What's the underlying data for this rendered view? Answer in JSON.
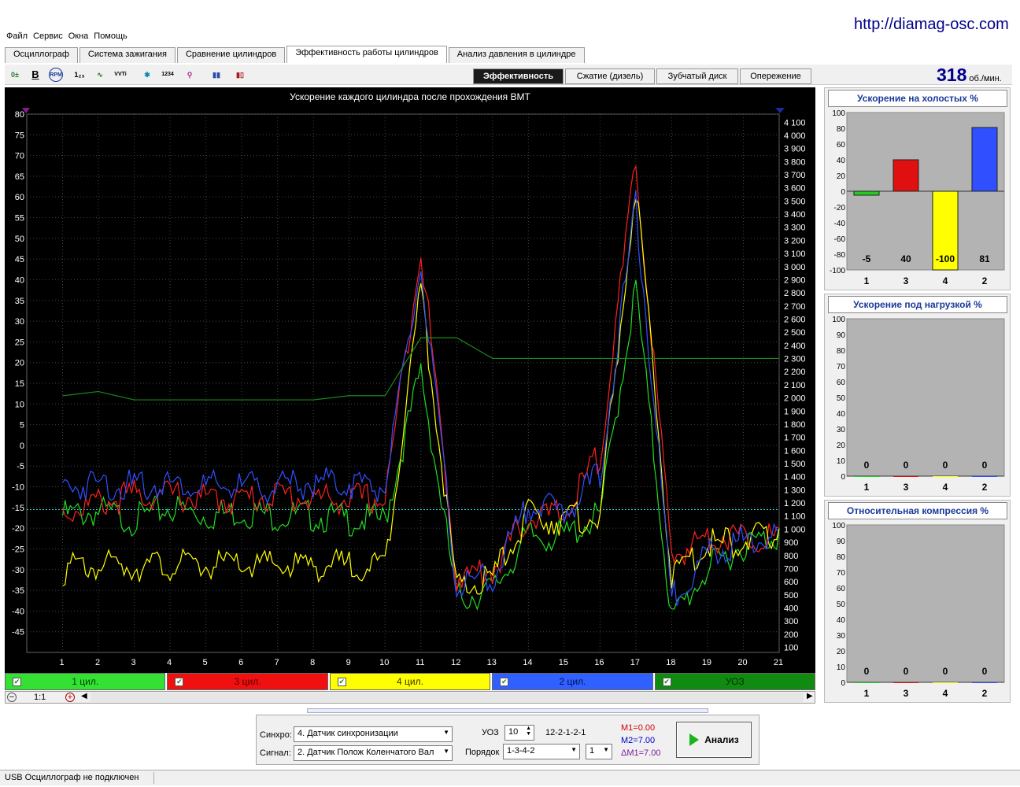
{
  "url": "http://diamag-osc.com",
  "menu": [
    "Файл",
    "Сервис",
    "Окна",
    "Помощь"
  ],
  "tabs": [
    {
      "label": "Осциллограф"
    },
    {
      "label": "Система зажигания"
    },
    {
      "label": "Сравнение цилиндров"
    },
    {
      "label": "Эффективность работы цилиндров",
      "active": true
    },
    {
      "label": "Анализ давления в цилиндре"
    }
  ],
  "subtabs": [
    {
      "label": "Эффективность",
      "active": true
    },
    {
      "label": "Сжатие (дизель)"
    },
    {
      "label": "Зубчатый диск"
    },
    {
      "label": "Опережение"
    }
  ],
  "rpm": {
    "value": "318",
    "unit": "об./мин."
  },
  "chart": {
    "title": "Ускорение каждого цилиндра после прохождения ВМТ",
    "left_ticks": [
      "80",
      "75",
      "70",
      "65",
      "60",
      "55",
      "50",
      "45",
      "40",
      "35",
      "30",
      "25",
      "20",
      "15",
      "10",
      "5",
      "0",
      "-5",
      "-10",
      "-15",
      "-20",
      "-25",
      "-30",
      "-35",
      "-40",
      "-45"
    ],
    "right_ticks": [
      "4 100",
      "4 000",
      "3 900",
      "3 800",
      "3 700",
      "3 600",
      "3 500",
      "3 400",
      "3 300",
      "3 200",
      "3 100",
      "3 000",
      "2 900",
      "2 800",
      "2 700",
      "2 600",
      "2 500",
      "2 400",
      "2 300",
      "2 200",
      "2 100",
      "2 000",
      "1 900",
      "1 800",
      "1 700",
      "1 600",
      "1 500",
      "1 400",
      "1 300",
      "1 200",
      "1 100",
      "1 000",
      "900",
      "800",
      "700",
      "600",
      "500",
      "400",
      "300",
      "200",
      "100"
    ],
    "x_ticks": [
      "1",
      "2",
      "3",
      "4",
      "5",
      "6",
      "7",
      "8",
      "9",
      "10",
      "11",
      "12",
      "13",
      "14",
      "15",
      "16",
      "17",
      "18",
      "19",
      "20",
      "21"
    ]
  },
  "chart_data": {
    "type": "line",
    "title": "Ускорение каждого цилиндра после прохождения ВМТ",
    "ylim": [
      -50,
      80
    ],
    "y2lim": [
      0,
      4100
    ],
    "x": [
      1,
      2,
      3,
      4,
      5,
      6,
      7,
      8,
      9,
      10,
      11,
      12,
      13,
      14,
      15,
      16,
      17,
      18,
      19,
      20,
      21
    ],
    "series": [
      {
        "name": "1 цил.",
        "color": "#22dd22",
        "values": [
          -15,
          -14,
          -16,
          -13,
          -15,
          -14,
          -15,
          -15,
          -16,
          -16,
          20,
          -35,
          -33,
          -20,
          -20,
          -15,
          40,
          -40,
          -28,
          -22,
          -20
        ]
      },
      {
        "name": "3 цил.",
        "color": "#ff2020",
        "values": [
          -14,
          -12,
          -10,
          -10,
          -11,
          -11,
          -10,
          -11,
          -11,
          -11,
          50,
          -30,
          -28,
          -15,
          -15,
          0,
          70,
          -25,
          -20,
          -20,
          -20
        ]
      },
      {
        "name": "4 цил.",
        "color": "#ffff00",
        "values": [
          -28,
          -27,
          -27,
          -27,
          -27,
          -27,
          -27,
          -27,
          -27,
          -27,
          40,
          -33,
          -30,
          -15,
          -16,
          -15,
          65,
          -30,
          -22,
          -21,
          -20
        ]
      },
      {
        "name": "2 цил.",
        "color": "#3050ff",
        "values": [
          -8,
          -7,
          -8,
          -7,
          -8,
          -8,
          -8,
          -7,
          -7,
          -8,
          45,
          -32,
          -30,
          -12,
          -14,
          -5,
          60,
          -35,
          -24,
          -21,
          -20
        ]
      },
      {
        "name": "УОЗ",
        "color": "#1a8a1a",
        "values": [
          12,
          13,
          11,
          11,
          11,
          11,
          11,
          11,
          12,
          12,
          26,
          26,
          21,
          21,
          21,
          21,
          21,
          21,
          21,
          21,
          21
        ]
      }
    ]
  },
  "legend": [
    {
      "label": "1 цил.",
      "bg": "#33e033",
      "fg": "#004400"
    },
    {
      "label": "3 цил.",
      "bg": "#f01010",
      "fg": "#550000"
    },
    {
      "label": "4 цил.",
      "bg": "#ffff00",
      "fg": "#333300"
    },
    {
      "label": "2 цил.",
      "bg": "#3060ff",
      "fg": "#001050"
    },
    {
      "label": "УОЗ",
      "bg": "#108a10",
      "fg": "#003300"
    }
  ],
  "zoom": "1:1",
  "panel": {
    "sync_label": "Синхро:",
    "sync_value": "4.  Датчик синхронизации",
    "signal_label": "Сигнал:",
    "signal_value": "2.  Датчик Полож Коленчатого Вал",
    "uoz_label": "УОЗ",
    "uoz_value": "10",
    "pattern": "12-2-1-2-1",
    "order_label": "Порядок",
    "order_value": "1-3-4-2",
    "order_num": "1",
    "m1": "M1=0.00",
    "m2": "M2=7.00",
    "dm1": "ΔM1=7.00",
    "analyze_label": "Анализ"
  },
  "side": [
    {
      "title": "Ускорение на холостых %",
      "ticks": [
        "100",
        "80",
        "60",
        "40",
        "20",
        "0",
        "-20",
        "-40",
        "-60",
        "-80",
        "-100"
      ],
      "ylim": [
        -100,
        100
      ],
      "bars": [
        {
          "cyl": "1",
          "value": -5,
          "color": "#22cc22"
        },
        {
          "cyl": "3",
          "value": 40,
          "color": "#e01010"
        },
        {
          "cyl": "4",
          "value": -100,
          "color": "#ffff00"
        },
        {
          "cyl": "2",
          "value": 81,
          "color": "#3050ff"
        }
      ]
    },
    {
      "title": "Ускорение под нагрузкой %",
      "ticks": [
        "100",
        "90",
        "80",
        "70",
        "60",
        "50",
        "40",
        "30",
        "20",
        "10",
        "0"
      ],
      "ylim": [
        0,
        100
      ],
      "bars": [
        {
          "cyl": "1",
          "value": 0,
          "color": "#22cc22"
        },
        {
          "cyl": "3",
          "value": 0,
          "color": "#e01010"
        },
        {
          "cyl": "4",
          "value": 0,
          "color": "#ffff00"
        },
        {
          "cyl": "2",
          "value": 0,
          "color": "#3050ff"
        }
      ]
    },
    {
      "title": "Относительная компрессия %",
      "ticks": [
        "100",
        "90",
        "80",
        "70",
        "60",
        "50",
        "40",
        "30",
        "20",
        "10",
        "0"
      ],
      "ylim": [
        0,
        100
      ],
      "bars": [
        {
          "cyl": "1",
          "value": 0,
          "color": "#22cc22"
        },
        {
          "cyl": "3",
          "value": 0,
          "color": "#e01010"
        },
        {
          "cyl": "4",
          "value": 0,
          "color": "#ffff00"
        },
        {
          "cyl": "2",
          "value": 0,
          "color": "#3050ff"
        }
      ]
    }
  ],
  "status": "USB Осциллограф не подключен"
}
